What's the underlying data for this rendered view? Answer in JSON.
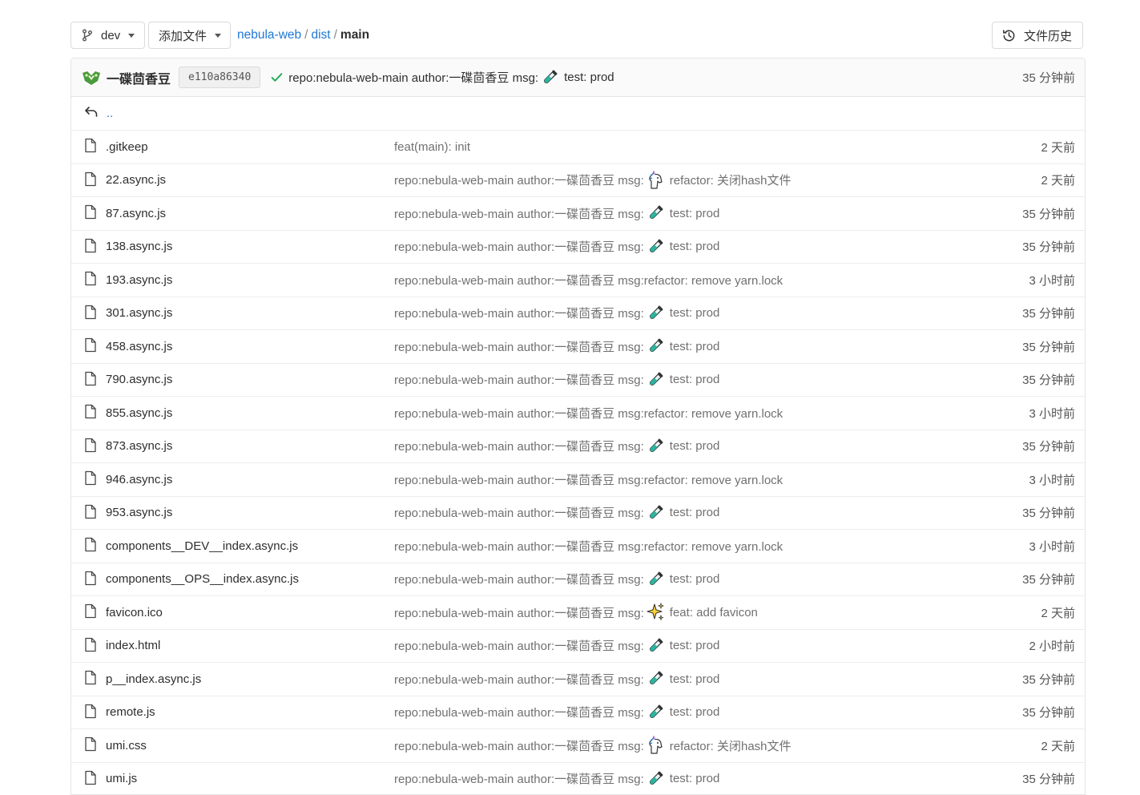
{
  "toolbar": {
    "branch": "dev",
    "add_file": "添加文件",
    "history": "文件历史"
  },
  "breadcrumb": {
    "project": "nebula-web",
    "sep1": "/",
    "folder": "dist",
    "sep2": "/",
    "current": "main"
  },
  "last_commit": {
    "author": "一碟茴香豆",
    "sha": "e110a86340",
    "message_prefix": "repo:nebula-web-main author:一碟茴香豆 msg:",
    "message_emoji": "test-tube-icon",
    "message_text": "test: prod",
    "time": "35 分钟前"
  },
  "parent_dir": "..",
  "files": [
    {
      "name": ".gitkeep",
      "msg_prefix": "feat(main): init",
      "emoji": "",
      "msg_text": "",
      "time": "2 天前"
    },
    {
      "name": "22.async.js",
      "msg_prefix": "repo:nebula-web-main author:一碟茴香豆 msg:",
      "emoji": "unicorn-icon",
      "msg_text": "refactor: 关闭hash文件",
      "time": "2 天前"
    },
    {
      "name": "87.async.js",
      "msg_prefix": "repo:nebula-web-main author:一碟茴香豆 msg:",
      "emoji": "test-tube-icon",
      "msg_text": "test: prod",
      "time": "35 分钟前"
    },
    {
      "name": "138.async.js",
      "msg_prefix": "repo:nebula-web-main author:一碟茴香豆 msg:",
      "emoji": "test-tube-icon",
      "msg_text": "test: prod",
      "time": "35 分钟前"
    },
    {
      "name": "193.async.js",
      "msg_prefix": "repo:nebula-web-main author:一碟茴香豆 msg:refactor: remove yarn.lock",
      "emoji": "",
      "msg_text": "",
      "time": "3 小时前"
    },
    {
      "name": "301.async.js",
      "msg_prefix": "repo:nebula-web-main author:一碟茴香豆 msg:",
      "emoji": "test-tube-icon",
      "msg_text": "test: prod",
      "time": "35 分钟前"
    },
    {
      "name": "458.async.js",
      "msg_prefix": "repo:nebula-web-main author:一碟茴香豆 msg:",
      "emoji": "test-tube-icon",
      "msg_text": "test: prod",
      "time": "35 分钟前"
    },
    {
      "name": "790.async.js",
      "msg_prefix": "repo:nebula-web-main author:一碟茴香豆 msg:",
      "emoji": "test-tube-icon",
      "msg_text": "test: prod",
      "time": "35 分钟前"
    },
    {
      "name": "855.async.js",
      "msg_prefix": "repo:nebula-web-main author:一碟茴香豆 msg:refactor: remove yarn.lock",
      "emoji": "",
      "msg_text": "",
      "time": "3 小时前"
    },
    {
      "name": "873.async.js",
      "msg_prefix": "repo:nebula-web-main author:一碟茴香豆 msg:",
      "emoji": "test-tube-icon",
      "msg_text": "test: prod",
      "time": "35 分钟前"
    },
    {
      "name": "946.async.js",
      "msg_prefix": "repo:nebula-web-main author:一碟茴香豆 msg:refactor: remove yarn.lock",
      "emoji": "",
      "msg_text": "",
      "time": "3 小时前"
    },
    {
      "name": "953.async.js",
      "msg_prefix": "repo:nebula-web-main author:一碟茴香豆 msg:",
      "emoji": "test-tube-icon",
      "msg_text": "test: prod",
      "time": "35 分钟前"
    },
    {
      "name": "components__DEV__index.async.js",
      "msg_prefix": "repo:nebula-web-main author:一碟茴香豆 msg:refactor: remove yarn.lock",
      "emoji": "",
      "msg_text": "",
      "time": "3 小时前"
    },
    {
      "name": "components__OPS__index.async.js",
      "msg_prefix": "repo:nebula-web-main author:一碟茴香豆 msg:",
      "emoji": "test-tube-icon",
      "msg_text": "test: prod",
      "time": "35 分钟前"
    },
    {
      "name": "favicon.ico",
      "msg_prefix": "repo:nebula-web-main author:一碟茴香豆 msg:",
      "emoji": "sparkles-icon",
      "msg_text": "feat: add favicon",
      "time": "2 天前"
    },
    {
      "name": "index.html",
      "msg_prefix": "repo:nebula-web-main author:一碟茴香豆 msg:",
      "emoji": "test-tube-icon",
      "msg_text": "test: prod",
      "time": "2 小时前"
    },
    {
      "name": "p__index.async.js",
      "msg_prefix": "repo:nebula-web-main author:一碟茴香豆 msg:",
      "emoji": "test-tube-icon",
      "msg_text": "test: prod",
      "time": "35 分钟前"
    },
    {
      "name": "remote.js",
      "msg_prefix": "repo:nebula-web-main author:一碟茴香豆 msg:",
      "emoji": "test-tube-icon",
      "msg_text": "test: prod",
      "time": "35 分钟前"
    },
    {
      "name": "umi.css",
      "msg_prefix": "repo:nebula-web-main author:一碟茴香豆 msg:",
      "emoji": "unicorn-icon",
      "msg_text": "refactor: 关闭hash文件",
      "time": "2 天前"
    },
    {
      "name": "umi.js",
      "msg_prefix": "repo:nebula-web-main author:一碟茴香豆 msg:",
      "emoji": "test-tube-icon",
      "msg_text": "test: prod",
      "time": "35 分钟前"
    }
  ],
  "colors": {
    "link": "#1f78d1",
    "success": "#1aaa55",
    "muted_text": "#707070"
  }
}
